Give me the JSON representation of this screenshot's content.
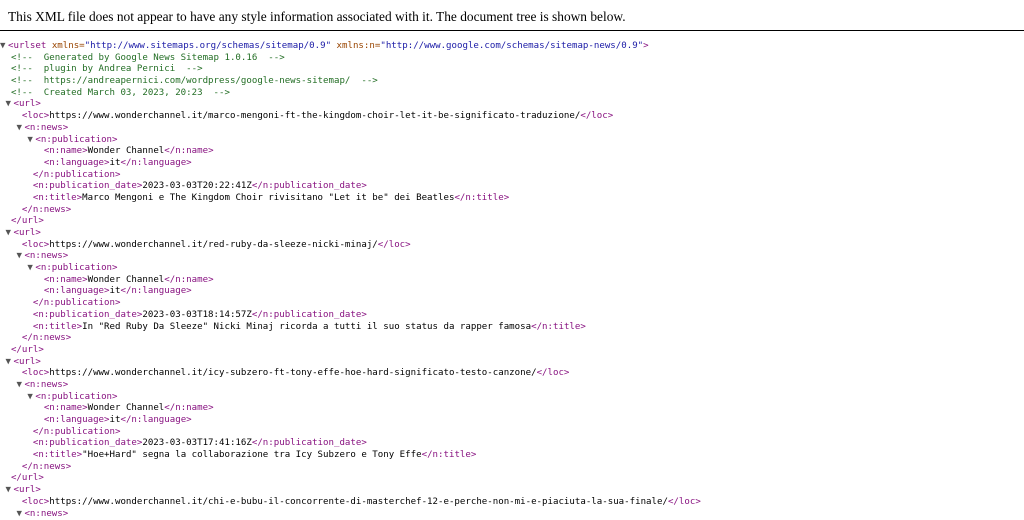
{
  "header": {
    "message": "This XML file does not appear to have any style information associated with it. The document tree is shown below."
  },
  "root": {
    "open": "<urlset",
    "ns_attr": "xmlns=",
    "ns_val": "\"http://www.sitemaps.org/schemas/sitemap/0.9\"",
    "news_attr": "xmlns:n=",
    "news_val": "\"http://www.google.com/schemas/sitemap-news/0.9\"",
    "close_bracket": ">"
  },
  "comments": [
    "<!--  Generated by Google News Sitemap 1.0.16  -->",
    "<!--  plugin by Andrea Pernici  -->",
    "<!--  https://andreapernici.com/wordpress/google-news-sitemap/  -->",
    "<!--  Created March 03, 2023, 20:23  -->"
  ],
  "tags": {
    "url_open": "<url>",
    "url_close": "</url>",
    "loc_open": "<loc>",
    "loc_close": "</loc>",
    "news_open": "<n:news>",
    "news_close": "</n:news>",
    "pub_open": "<n:publication>",
    "pub_close": "</n:publication>",
    "name_open": "<n:name>",
    "name_close": "</n:name>",
    "lang_open": "<n:language>",
    "lang_close": "</n:language>",
    "date_open": "<n:publication_date>",
    "date_close": "</n:publication_date>",
    "title_open": "<n:title>",
    "title_close": "</n:title>"
  },
  "toggle_glyph": "▼",
  "urls": [
    {
      "loc": "https://www.wonderchannel.it/marco-mengoni-ft-the-kingdom-choir-let-it-be-significato-traduzione/",
      "name": "Wonder Channel",
      "language": "it",
      "date": "2023-03-03T20:22:41Z",
      "title": "Marco Mengoni e The Kingdom Choir rivisitano \"Let it be\" dei Beatles"
    },
    {
      "loc": "https://www.wonderchannel.it/red-ruby-da-sleeze-nicki-minaj/",
      "name": "Wonder Channel",
      "language": "it",
      "date": "2023-03-03T18:14:57Z",
      "title": "In \"Red Ruby Da Sleeze\" Nicki Minaj ricorda a tutti il suo status da rapper famosa"
    },
    {
      "loc": "https://www.wonderchannel.it/icy-subzero-ft-tony-effe-hoe-hard-significato-testo-canzone/",
      "name": "Wonder Channel",
      "language": "it",
      "date": "2023-03-03T17:41:16Z",
      "title": "\"Hoe+Hard\" segna la collaborazione tra Icy Subzero e Tony Effe"
    },
    {
      "loc": "https://www.wonderchannel.it/chi-e-bubu-il-concorrente-di-masterchef-12-e-perche-non-mi-e-piaciuta-la-sua-finale/"
    }
  ]
}
